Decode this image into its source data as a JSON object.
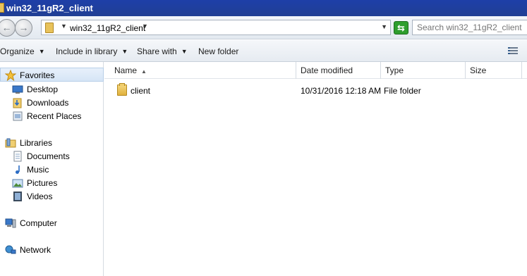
{
  "window": {
    "title": "win32_11gR2_client"
  },
  "address": {
    "crumb": "win32_11gR2_client",
    "search_placeholder": "Search win32_11gR2_client"
  },
  "commands": [
    "Organize",
    "Include in library",
    "Share with",
    "New folder"
  ],
  "nav": {
    "favorites": {
      "label": "Favorites",
      "items": [
        "Desktop",
        "Downloads",
        "Recent Places"
      ]
    },
    "libraries": {
      "label": "Libraries",
      "items": [
        "Documents",
        "Music",
        "Pictures",
        "Videos"
      ]
    },
    "computer": "Computer",
    "network": "Network"
  },
  "columns": [
    "Name",
    "Date modified",
    "Type",
    "Size"
  ],
  "files": [
    {
      "name": "client",
      "date": "10/31/2016 12:18 AM",
      "type": "File folder",
      "size": ""
    }
  ]
}
